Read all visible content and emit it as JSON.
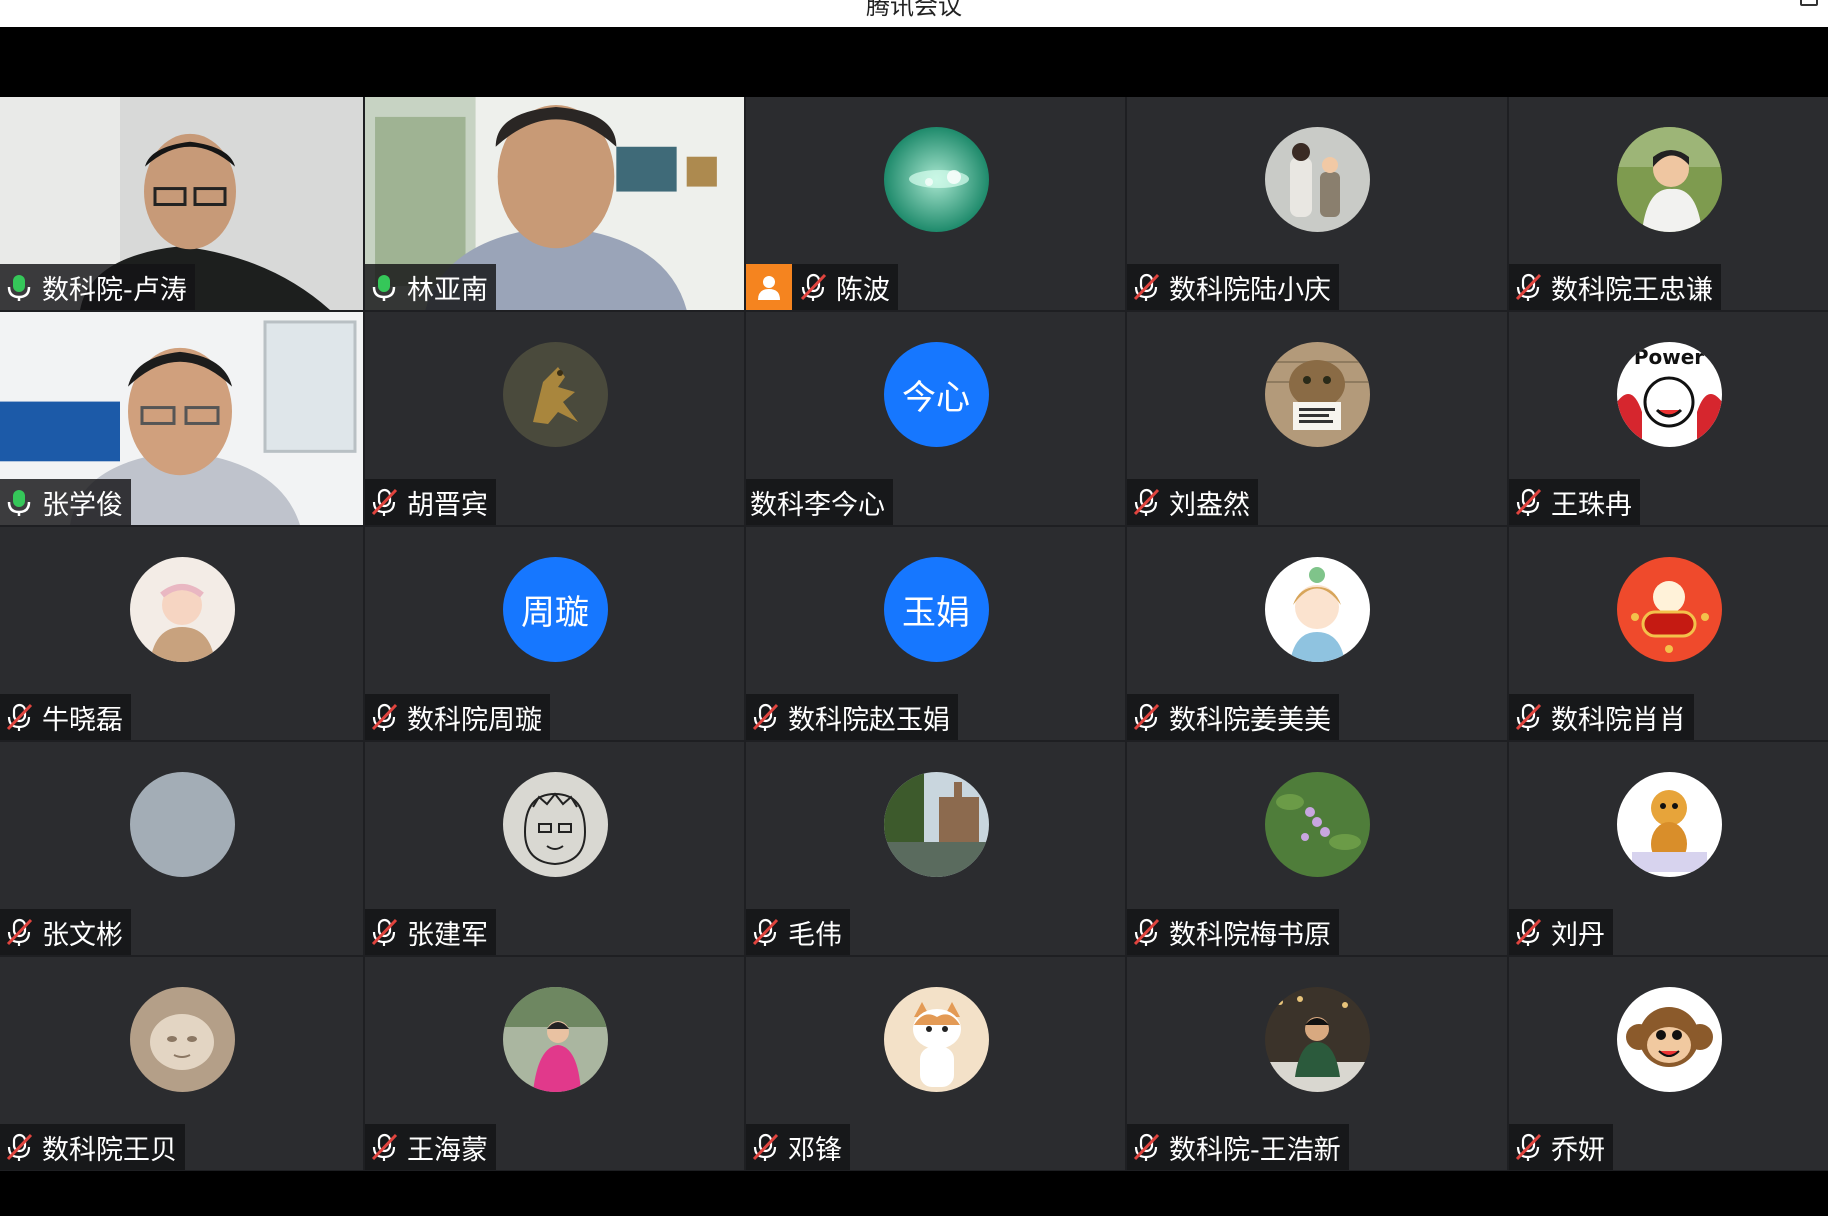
{
  "window": {
    "title": "腾讯会议"
  },
  "colors": {
    "mic_on": "#35c759",
    "mic_muted_slash": "#e0443e",
    "host_badge": "#f5841f",
    "text_avatar_bg": "#1677ff"
  },
  "participants": [
    {
      "name": "数科院-卢涛",
      "mic": "on",
      "avatar": "video-feed-man-glasses"
    },
    {
      "name": "林亚南",
      "mic": "on",
      "avatar": "video-feed-man-living-room"
    },
    {
      "name": "陈波",
      "mic": "muted",
      "host_badge": true,
      "avatar": "water-droplet-photo"
    },
    {
      "name": "数科院陆小庆",
      "mic": "muted",
      "avatar": "family-photo"
    },
    {
      "name": "数科院王忠谦",
      "mic": "muted",
      "avatar": "child-photo"
    },
    {
      "name": "张学俊",
      "mic": "on",
      "avatar": "video-feed-man-office"
    },
    {
      "name": "胡晋宾",
      "mic": "muted",
      "avatar": "bronze-bird-photo"
    },
    {
      "name": "数科李今心",
      "mic": "none",
      "avatar_text": "今心"
    },
    {
      "name": "刘盎然",
      "mic": "muted",
      "avatar": "cat-holding-sign-photo"
    },
    {
      "name": "王珠冉",
      "mic": "muted",
      "avatar": "power-cartoon"
    },
    {
      "name": "牛晓磊",
      "mic": "muted",
      "avatar": "baby-photo"
    },
    {
      "name": "数科院周璇",
      "mic": "muted",
      "avatar_text": "周璇"
    },
    {
      "name": "数科院赵玉娟",
      "mic": "muted",
      "avatar_text": "玉娟"
    },
    {
      "name": "数科院姜美美",
      "mic": "muted",
      "avatar": "anime-boy-illustration"
    },
    {
      "name": "数科院肖肖",
      "mic": "muted",
      "avatar": "tiger-new-year-cartoon"
    },
    {
      "name": "张文彬",
      "mic": "muted",
      "avatar": "gray-blank"
    },
    {
      "name": "张建军",
      "mic": "muted",
      "avatar": "sketch-face-drawing"
    },
    {
      "name": "毛伟",
      "mic": "muted",
      "avatar": "river-town-photo"
    },
    {
      "name": "数科院梅书原",
      "mic": "muted",
      "avatar": "flowers-photo"
    },
    {
      "name": "刘丹",
      "mic": "muted",
      "avatar": "lion-cartoon"
    },
    {
      "name": "数科院王贝",
      "mic": "muted",
      "avatar": "sand-sculpture-photo"
    },
    {
      "name": "王海蒙",
      "mic": "muted",
      "avatar": "woman-pink-jacket-photo"
    },
    {
      "name": "邓锋",
      "mic": "muted",
      "avatar": "kitten-photo"
    },
    {
      "name": "数科院-王浩新",
      "mic": "muted",
      "avatar": "man-restaurant-photo"
    },
    {
      "name": "乔妍",
      "mic": "muted",
      "avatar": "monkey-cartoon"
    }
  ]
}
